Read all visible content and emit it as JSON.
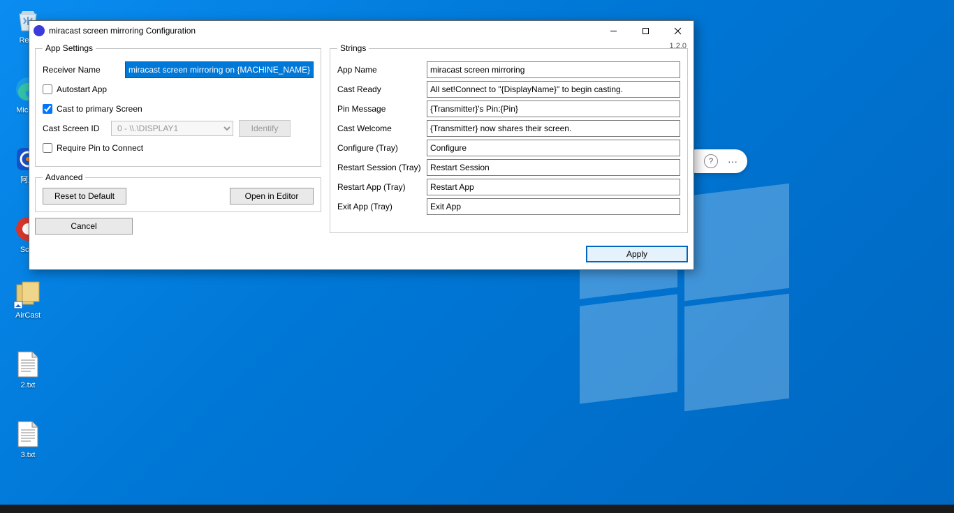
{
  "desktop": {
    "icons": [
      {
        "name": "recycle-bin",
        "label": "Recy"
      },
      {
        "name": "edge",
        "label": "Mic Ed"
      },
      {
        "name": "ali",
        "label": "阿里"
      },
      {
        "name": "screenshot",
        "label": "Scre"
      },
      {
        "name": "aircast",
        "label": "AirCast"
      },
      {
        "name": "txt2",
        "label": "2.txt"
      },
      {
        "name": "txt3",
        "label": "3.txt"
      }
    ]
  },
  "pill": {
    "help": "?",
    "more": "···"
  },
  "dialog": {
    "title": "miracast screen mirroring Configuration",
    "version": "1.2.0",
    "app_settings": {
      "legend": "App Settings",
      "receiver_name_label": "Receiver Name",
      "receiver_name": "miracast screen mirroring on {MACHINE_NAME}",
      "autostart_label": "Autostart App",
      "autostart": false,
      "cast_primary_label": "Cast to primary Screen",
      "cast_primary": true,
      "cast_screen_id_label": "Cast Screen ID",
      "cast_screen_id_value": "0 - \\\\.\\DISPLAY1",
      "identify_label": "Identify",
      "require_pin_label": "Require Pin to Connect",
      "require_pin": false
    },
    "advanced": {
      "legend": "Advanced",
      "reset": "Reset to Default",
      "open_editor": "Open in Editor"
    },
    "strings": {
      "legend": "Strings",
      "rows": [
        {
          "label": "App Name",
          "value": "miracast screen mirroring"
        },
        {
          "label": "Cast Ready",
          "value": "All set!Connect to \"{DisplayName}\" to begin casting."
        },
        {
          "label": "Pin Message",
          "value": "{Transmitter}'s Pin:{Pin}"
        },
        {
          "label": "Cast Welcome",
          "value": "{Transmitter} now shares their screen."
        },
        {
          "label": "Configure (Tray)",
          "value": "Configure"
        },
        {
          "label": "Restart Session (Tray)",
          "value": "Restart Session"
        },
        {
          "label": "Restart App (Tray)",
          "value": "Restart App"
        },
        {
          "label": "Exit App (Tray)",
          "value": "Exit App"
        }
      ]
    },
    "footer": {
      "cancel": "Cancel",
      "apply": "Apply"
    }
  }
}
